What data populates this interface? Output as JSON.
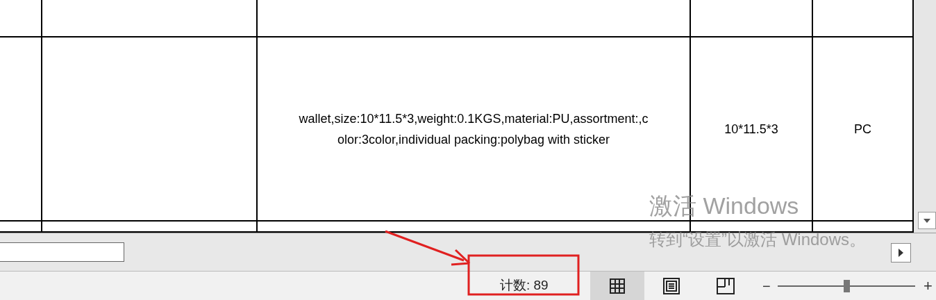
{
  "sheet": {
    "data_row": {
      "description_lines": [
        "wallet,size:10*11.5*3,weight:0.1KGS,material:PU,assortment:,c",
        "olor:3color,individual packing:polybag with sticker"
      ],
      "size": "10*11.5*3",
      "unit": "PC"
    }
  },
  "status_bar": {
    "count": "计数: 89",
    "view_buttons": [
      {
        "kind": "normal",
        "selected": true
      },
      {
        "kind": "page_layout",
        "selected": false
      },
      {
        "kind": "page_break",
        "selected": false
      }
    ],
    "zoom": {
      "out": "−",
      "in": "+",
      "level": 0.5
    }
  },
  "activation_notice": {
    "title": "激活 Windows",
    "message": "转到“设置”以激活 Windows。"
  }
}
